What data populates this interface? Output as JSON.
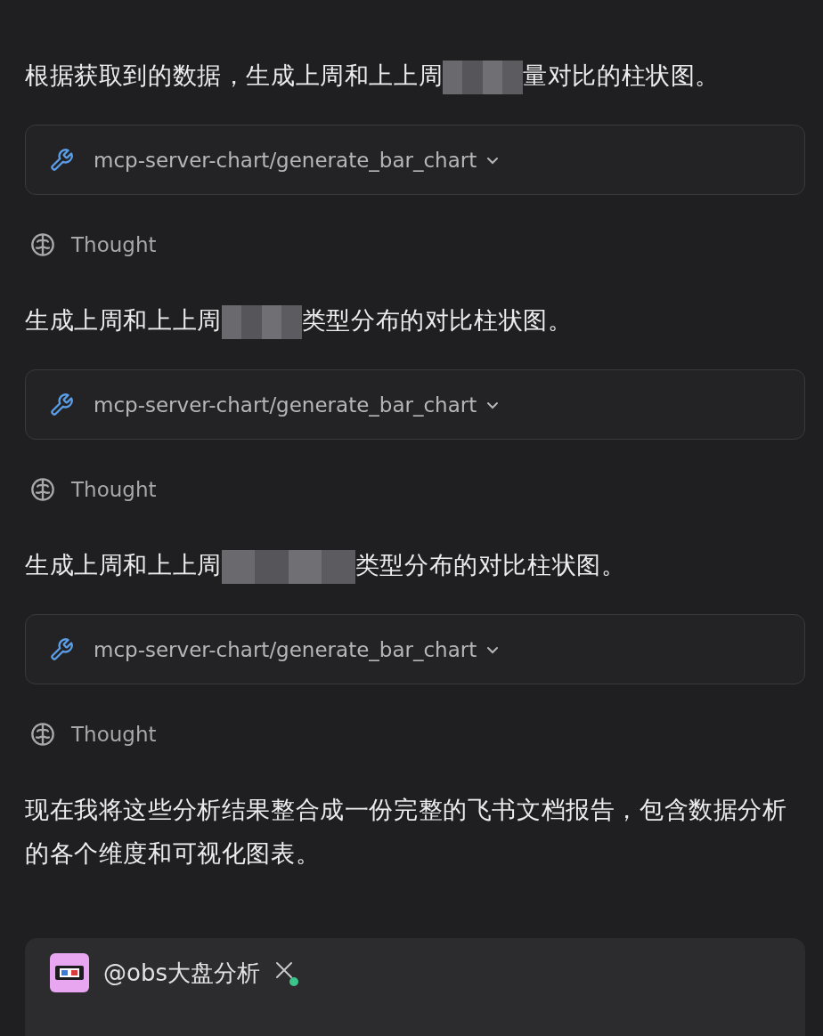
{
  "messages": [
    {
      "kind": "paragraph",
      "parts": [
        {
          "kind": "text",
          "text": "根据获取到的数据，生成上周和上上周"
        },
        {
          "kind": "redacted"
        },
        {
          "kind": "text",
          "text": "量对比的柱状图。"
        }
      ]
    },
    {
      "kind": "tool_call",
      "label": "mcp-server-chart/generate_bar_chart",
      "expanded": false
    },
    {
      "kind": "thought",
      "label": "Thought"
    },
    {
      "kind": "paragraph",
      "parts": [
        {
          "kind": "text",
          "text": "生成上周和上上周"
        },
        {
          "kind": "redacted"
        },
        {
          "kind": "text",
          "text": "类型分布的对比柱状图。"
        }
      ]
    },
    {
      "kind": "tool_call",
      "label": "mcp-server-chart/generate_bar_chart",
      "expanded": false
    },
    {
      "kind": "thought",
      "label": "Thought"
    },
    {
      "kind": "paragraph",
      "parts": [
        {
          "kind": "text",
          "text": "生成上周和上上周"
        },
        {
          "kind": "redacted_wide"
        },
        {
          "kind": "text",
          "text": "类型分布的对比柱状图。"
        }
      ]
    },
    {
      "kind": "tool_call",
      "label": "mcp-server-chart/generate_bar_chart",
      "expanded": false
    },
    {
      "kind": "thought",
      "label": "Thought"
    },
    {
      "kind": "paragraph",
      "parts": [
        {
          "kind": "text",
          "text": "现在我将这些分析结果整合成一份完整的飞书文档报告，包含数据分析的各个维度和可视化图表。"
        }
      ]
    }
  ],
  "composer": {
    "agent": "@obs大盘分析",
    "online": true
  }
}
